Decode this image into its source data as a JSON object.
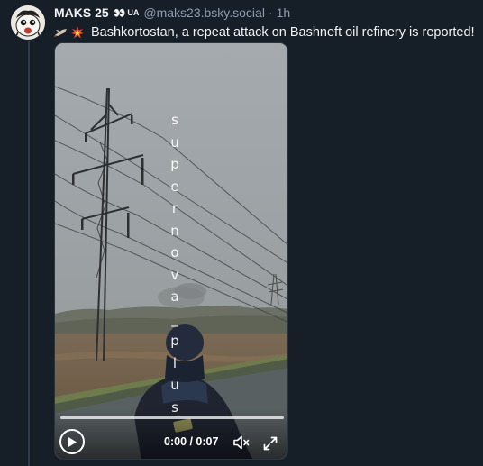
{
  "post": {
    "author": {
      "display_name": "MAKS 25",
      "name_emoji": "👀",
      "name_flag": "UA",
      "handle": "@maks23.bsky.social",
      "separator": "·",
      "time": "1h"
    },
    "icons": [
      "drone-icon",
      "explosion-icon"
    ],
    "text": "Bashkortostan, a repeat attack on Bashneft oil refinery is reported!",
    "video": {
      "watermark": [
        "s",
        "u",
        "p",
        "e",
        "r",
        "n",
        "o",
        "v",
        "a",
        "_",
        "p",
        "l",
        "u",
        "s"
      ],
      "time_readout": "0:00 / 0:07",
      "progress": 0
    }
  },
  "colors": {
    "background": "#161e27",
    "thread_line": "#2c3a4a",
    "muted_text": "#8d9db0"
  }
}
